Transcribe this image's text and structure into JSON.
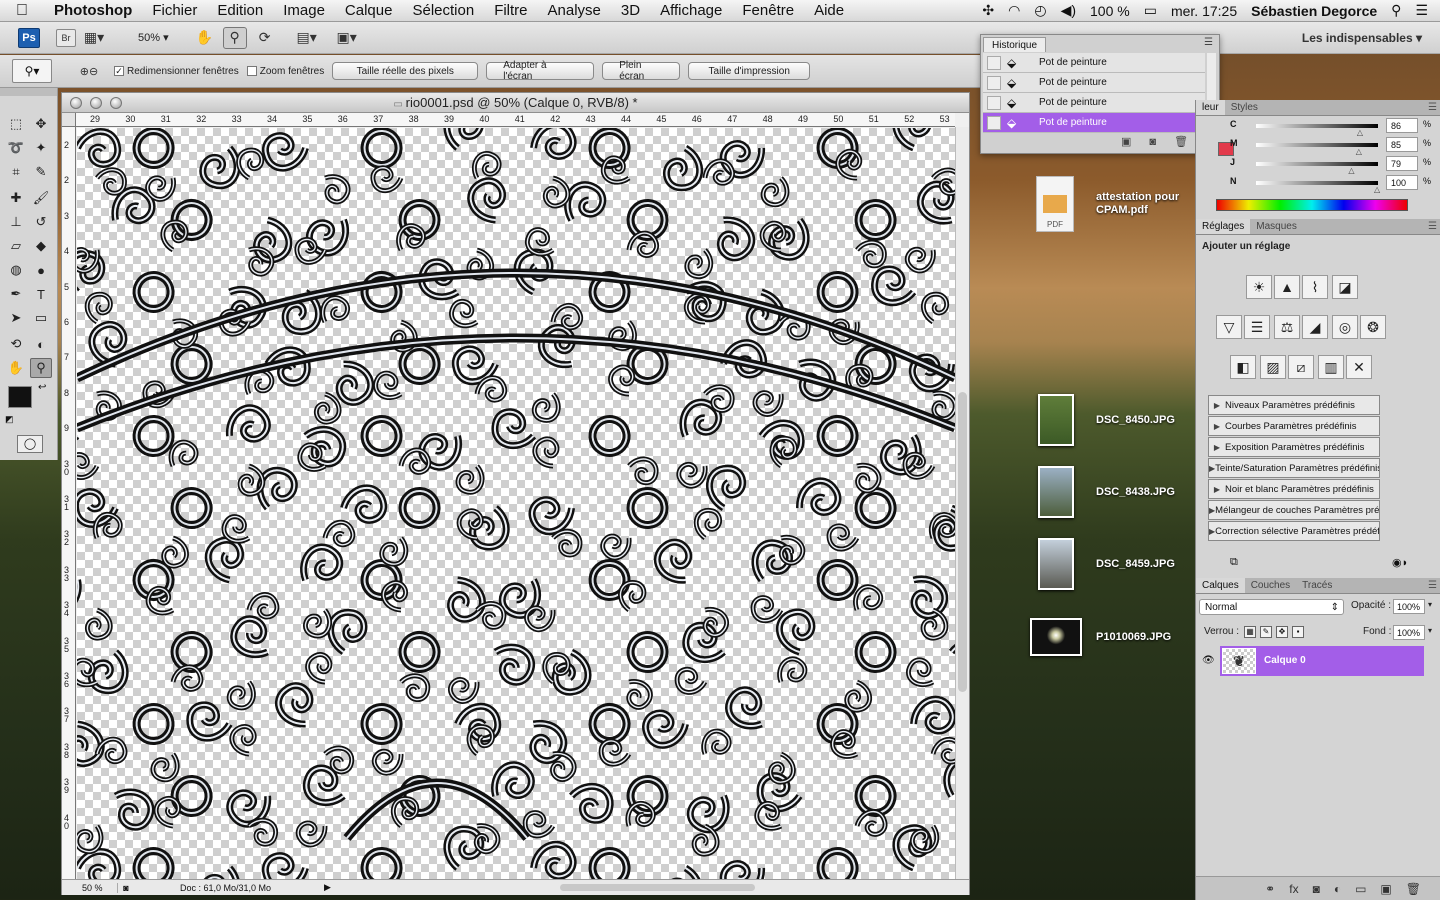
{
  "menubar": {
    "apple": "",
    "app": "Photoshop",
    "items": [
      "Fichier",
      "Edition",
      "Image",
      "Calque",
      "Sélection",
      "Filtre",
      "Analyse",
      "3D",
      "Affichage",
      "Fenêtre",
      "Aide"
    ],
    "battery": "100 %",
    "clock": "mer. 17:25",
    "user": "Sébastien Degorce"
  },
  "appbar": {
    "ps": "Ps",
    "br": "Br",
    "zoom": "50%",
    "workspace": "Les indispensables ▾"
  },
  "options": {
    "resize_windows": "Redimensionner fenêtres",
    "zoom_all": "Zoom fenêtres",
    "btn_actual": "Taille réelle des pixels",
    "btn_fit": "Adapter à l'écran",
    "btn_full": "Plein écran",
    "btn_print": "Taille d'impression"
  },
  "document": {
    "title": "rio0001.psd @ 50% (Calque 0, RVB/8) *",
    "zoom": "50 %",
    "doc_info": "Doc : 61,0 Mo/31,0 Mo",
    "ruler_h": [
      "29",
      "30",
      "31",
      "32",
      "33",
      "34",
      "35",
      "36",
      "37",
      "38",
      "39",
      "40",
      "41",
      "42",
      "43",
      "44",
      "45",
      "46",
      "47",
      "48",
      "49",
      "50",
      "51",
      "52",
      "53"
    ],
    "ruler_v": [
      "2",
      "2",
      "3",
      "4",
      "5",
      "6",
      "7",
      "8",
      "9",
      "3 0",
      "3 1",
      "3 2",
      "3 3",
      "3 4",
      "3 5",
      "3 6",
      "3 7",
      "3 8",
      "3 9",
      "4 0"
    ]
  },
  "history": {
    "tab": "Historique",
    "items": [
      {
        "label": "Pot de peinture",
        "selected": false
      },
      {
        "label": "Pot de peinture",
        "selected": false
      },
      {
        "label": "Pot de peinture",
        "selected": false
      },
      {
        "label": "Pot de peinture",
        "selected": true
      }
    ]
  },
  "color": {
    "tabs": [
      "leur",
      "Styles"
    ],
    "rows": [
      {
        "k": "C",
        "v": "86"
      },
      {
        "k": "M",
        "v": "85"
      },
      {
        "k": "J",
        "v": "79"
      },
      {
        "k": "N",
        "v": "100"
      }
    ],
    "pct": "%",
    "foreground": "#e23a4b"
  },
  "adjust": {
    "tabs": [
      "Réglages",
      "Masques"
    ],
    "heading": "Ajouter un réglage",
    "presets": [
      "Niveaux Paramètres prédéfinis",
      "Courbes Paramètres prédéfinis",
      "Exposition Paramètres prédéfinis",
      "Teinte/Saturation Paramètres prédéfinis",
      "Noir et blanc Paramètres prédéfinis",
      "Mélangeur de couches Paramètres préd...",
      "Correction sélective Paramètres prédéfi..."
    ]
  },
  "layers": {
    "tabs": [
      "Calques",
      "Couches",
      "Tracés"
    ],
    "blend": "Normal",
    "opacity_label": "Opacité :",
    "opacity": "100%",
    "lock_label": "Verrou :",
    "fill_label": "Fond :",
    "fill": "100%",
    "layer_name": "Calque 0"
  },
  "desktop": [
    {
      "name": "attestation pour CPAM.pdf",
      "badge": "PDF"
    },
    {
      "name": "DSC_8450.JPG"
    },
    {
      "name": "DSC_8438.JPG"
    },
    {
      "name": "DSC_8459.JPG"
    },
    {
      "name": "P1010069.JPG"
    }
  ],
  "colors": {
    "selection": "#a35ee8",
    "foreground": "#111111",
    "background": "#e23a4b"
  }
}
